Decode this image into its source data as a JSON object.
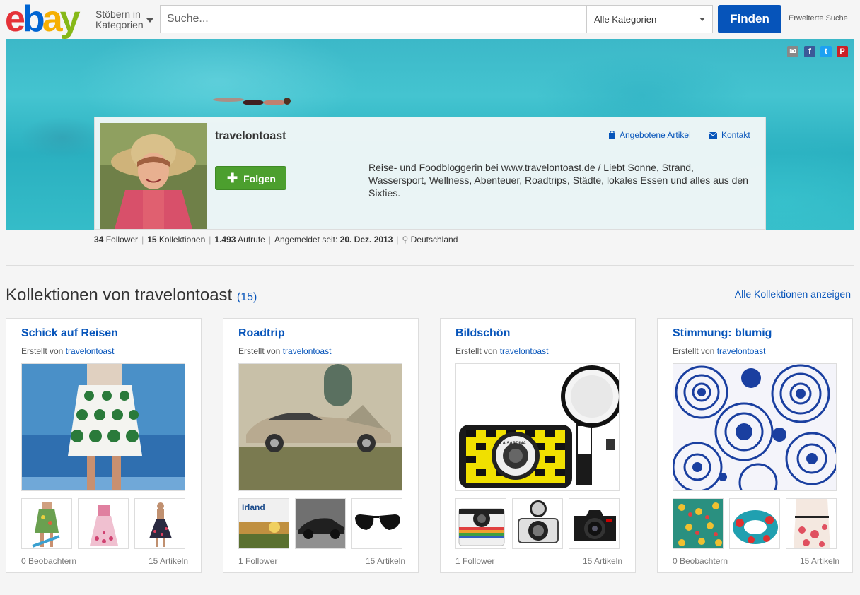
{
  "header": {
    "logo_letters": [
      "e",
      "b",
      "a",
      "y"
    ],
    "browse_line1": "Stöbern in",
    "browse_line2": "Kategorien",
    "search_placeholder": "Suche...",
    "category": "Alle Kategorien",
    "find_label": "Finden",
    "advanced_label": "Erweiterte Suche",
    "colors": {
      "e": "#e53238",
      "b": "#0064d2",
      "a": "#f5af02",
      "y": "#86b817",
      "primary": "#0654ba"
    }
  },
  "social": [
    "email-icon",
    "facebook-icon",
    "twitter-icon",
    "pinterest-icon"
  ],
  "profile": {
    "username": "travelontoast",
    "follow_label": "Folgen",
    "bio": "Reise- und Foodbloggerin bei www.travelontoast.de / Liebt Sonne, Strand, Wassersport, Wellness, Abenteuer, Roadtrips, Städte, lokales Essen und alles aus den Sixties.",
    "offered_items_label": "Angebotene Artikel",
    "contact_label": "Kontakt"
  },
  "stats": {
    "followers_count": "34",
    "followers_label": "Follower",
    "collections_count": "15",
    "collections_label": "Kollektionen",
    "views_count": "1.493",
    "views_label": "Aufrufe",
    "since_label": "Angemeldet seit:",
    "since_date": "20. Dez. 2013",
    "location": "Deutschland"
  },
  "section": {
    "title": "Kollektionen von travelontoast",
    "count": "(15)",
    "all_label": "Alle Kollektionen anzeigen"
  },
  "collections": [
    {
      "title": "Schick auf Reisen",
      "by_label": "Erstellt von",
      "by_user": "travelontoast",
      "footer_left": "0 Beobachtern",
      "footer_right": "15 Artikeln"
    },
    {
      "title": "Roadtrip",
      "by_label": "Erstellt von",
      "by_user": "travelontoast",
      "footer_left": "1 Follower",
      "footer_right": "15 Artikeln",
      "thumb_text": "Irland"
    },
    {
      "title": "Bildschön",
      "by_label": "Erstellt von",
      "by_user": "travelontoast",
      "footer_left": "1 Follower",
      "footer_right": "15 Artikeln",
      "camera_label": "LA SARDINA"
    },
    {
      "title": "Stimmung: blumig",
      "by_label": "Erstellt von",
      "by_user": "travelontoast",
      "footer_left": "0 Beobachtern",
      "footer_right": "15 Artikeln"
    }
  ]
}
